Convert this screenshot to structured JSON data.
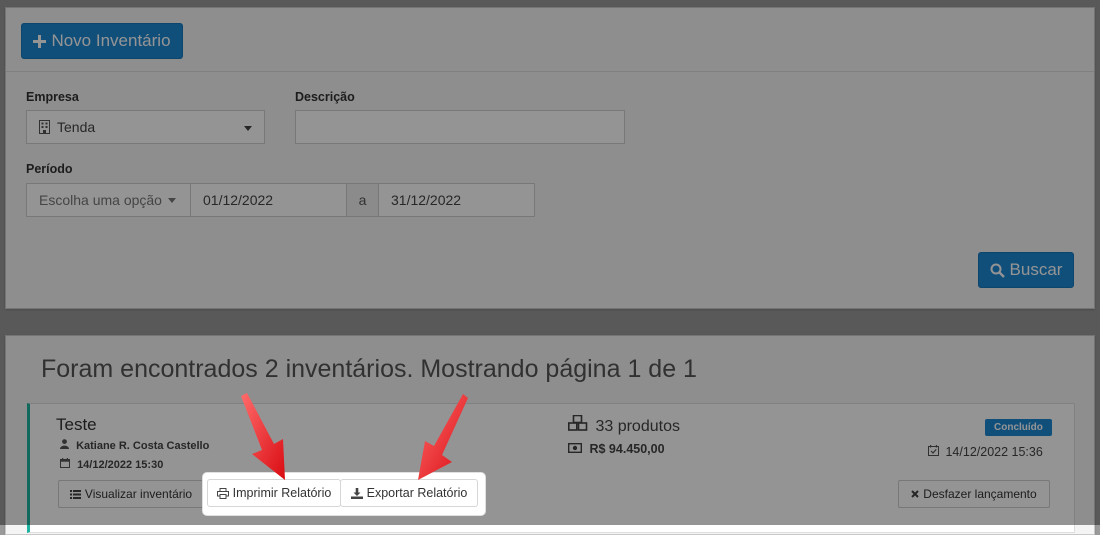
{
  "toolbar": {
    "new_inventory_label": "Novo Inventário"
  },
  "filters": {
    "empresa_label": "Empresa",
    "empresa_value": "Tenda",
    "descricao_label": "Descrição",
    "descricao_value": "",
    "periodo_label": "Período",
    "periodo_select": "Escolha uma opção",
    "date_from": "01/12/2022",
    "date_separator": "a",
    "date_to": "31/12/2022",
    "search_label": "Buscar"
  },
  "results": {
    "summary": "Foram encontrados 2 inventários. Mostrando página 1 de 1",
    "item": {
      "title": "Teste",
      "user": "Katiane R. Costa Castello",
      "created_at": "14/12/2022 15:30",
      "products": "33 produtos",
      "value": "R$ 94.450,00",
      "status": "Concluído",
      "status_color": "#1e88d4",
      "concluded_at": "14/12/2022 15:36",
      "view_label": "Visualizar inventário",
      "print_label": "Imprimir Relatório",
      "export_label": "Exportar Relatório",
      "undo_label": "Desfazer lançamento"
    }
  },
  "colors": {
    "primary": "#1e88d4",
    "accent_bar": "#1eb3a0",
    "annotation_arrow": "#e8141c"
  }
}
